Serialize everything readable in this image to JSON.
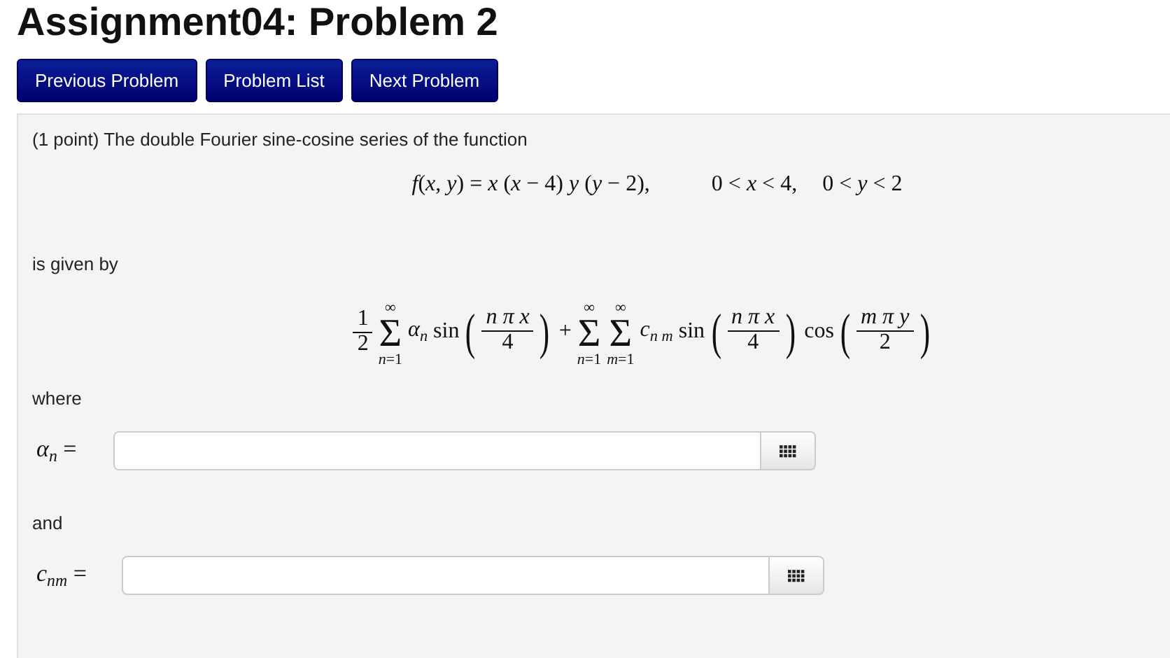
{
  "page": {
    "title": "Assignment04: Problem 2"
  },
  "nav_buttons": [
    "Previous Problem",
    "Problem List",
    "Next Problem"
  ],
  "problem": {
    "content": [
      {
        "kind": "text",
        "text": "(1 point) The double Fourier sine-cosine series of the function"
      },
      {
        "kind": "formula",
        "parts": [
          {
            "kind": "math",
            "text": "*f*(*x*, *y*) = *x* (*x* − 4) *y* (*y* − 2),"
          },
          {
            "kind": "math",
            "text": "0 < *x* < 4,"
          },
          {
            "kind": "math",
            "text": "0 < *y* < 2"
          }
        ]
      },
      {
        "kind": "text",
        "text": "is given by"
      },
      {
        "kind": "formula",
        "parts": [
          {
            "kind": "frac",
            "num": "1",
            "den": "2"
          },
          {
            "kind": "sum",
            "top": "∞",
            "symbol": "Σ",
            "bottom": "*n*=1"
          },
          {
            "kind": "math",
            "text": "*α*$_{n}$"
          },
          {
            "kind": "func",
            "name": "sin",
            "open": "(",
            "num": "*n* *π* *x*",
            "den": "4",
            "close": ")"
          },
          {
            "kind": "math",
            "text": "+"
          },
          {
            "kind": "sum",
            "top": "∞",
            "symbol": "Σ",
            "bottom": "*n*=1"
          },
          {
            "kind": "sum",
            "top": "∞",
            "symbol": "Σ",
            "bottom": "*m*=1"
          },
          {
            "kind": "math",
            "text": "*c*$_{n m}$"
          },
          {
            "kind": "func",
            "name": "sin",
            "open": "(",
            "num": "*n* *π* *x*",
            "den": "4",
            "close": ")"
          },
          {
            "kind": "func",
            "name": "cos",
            "open": "(",
            "num": "*m* *π* *y*",
            "den": "2",
            "close": ")"
          }
        ]
      },
      {
        "kind": "text",
        "text": "where"
      },
      {
        "kind": "answer",
        "label": "*α*$_{n}$",
        "equals": "="
      },
      {
        "kind": "text",
        "text": "and"
      },
      {
        "kind": "answer",
        "label": "*c*$_{nm}$",
        "equals": "="
      }
    ]
  }
}
